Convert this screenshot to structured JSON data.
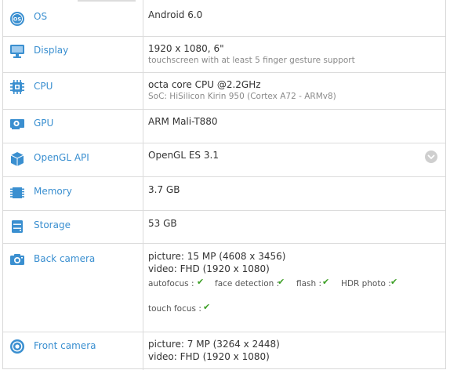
{
  "colors": {
    "label": "#3a8fd0",
    "icon": "#3a8fd0",
    "check": "#3a9e22",
    "border": "#dcdcdc",
    "expand": "#cfcfcf"
  },
  "specs": {
    "os": {
      "label": "OS",
      "icon": "os-icon",
      "value": "Android 6.0"
    },
    "display": {
      "label": "Display",
      "icon": "display-icon",
      "value": "1920 x 1080, 6\"",
      "sub": "touchscreen with at least 5 finger gesture support"
    },
    "cpu": {
      "label": "CPU",
      "icon": "cpu-chip-icon",
      "value": "octa core CPU @2.2GHz",
      "sub": "SoC: HiSilicon Kirin 950 (Cortex A72 - ARMv8)"
    },
    "gpu": {
      "label": "GPU",
      "icon": "gpu-card-icon",
      "value": "ARM Mali-T880"
    },
    "opengl": {
      "label": "OpenGL API",
      "icon": "opengl-cube-icon",
      "value": "OpenGL ES 3.1",
      "expand_icon": "chevron-down-circle-icon"
    },
    "memory": {
      "label": "Memory",
      "icon": "memory-module-icon",
      "value": "3.7 GB"
    },
    "storage": {
      "label": "Storage",
      "icon": "storage-drive-icon",
      "value": "53 GB"
    },
    "back_camera": {
      "label": "Back camera",
      "icon": "camera-icon",
      "picture": "picture: 15 MP (4608 x 3456)",
      "video": "video: FHD (1920 x 1080)",
      "features": [
        {
          "label": "autofocus :",
          "supported": true
        },
        {
          "label": "face detection :",
          "supported": true
        },
        {
          "label": "flash :",
          "supported": true
        },
        {
          "label": "HDR photo :",
          "supported": true
        },
        {
          "label": "touch focus :",
          "supported": true
        }
      ]
    },
    "front_camera": {
      "label": "Front camera",
      "icon": "front-camera-icon",
      "picture": "picture: 7 MP (3264 x 2448)",
      "video": "video: FHD (1920 x 1080)"
    }
  }
}
